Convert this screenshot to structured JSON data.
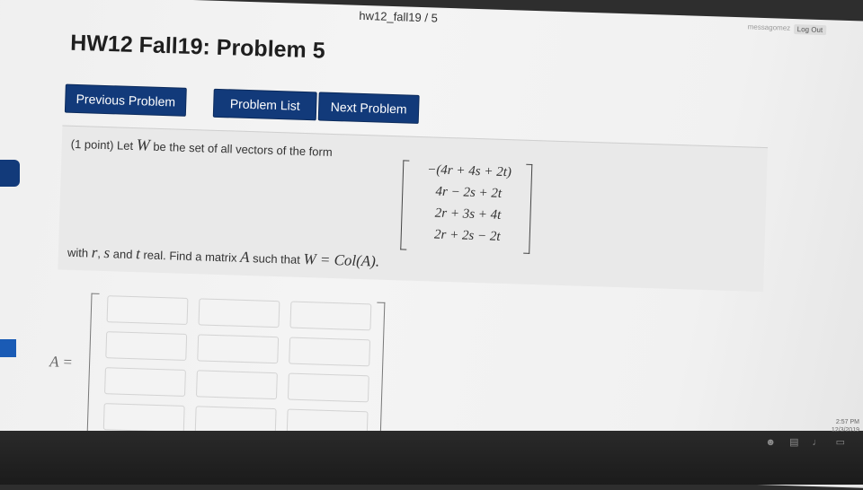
{
  "header": {
    "breadcrumb": "hw12_fall19 / 5",
    "username": "messagomez",
    "logout_label": "Log Out"
  },
  "page": {
    "title": "HW12 Fall19: Problem 5"
  },
  "nav": {
    "prev_label": "Previous Problem",
    "list_label": "Problem List",
    "next_label": "Next Problem"
  },
  "problem": {
    "points": "(1 point) Let",
    "var_W": "W",
    "intro_rest": "be the set of all vectors of the form",
    "vector_rows": [
      "−(4r + 4s + 2t)",
      "4r − 2s + 2t",
      "2r + 3s + 4t",
      "2r + 2s − 2t"
    ],
    "with_text": "with",
    "var_r": "r",
    "comma": ",",
    "var_s": "s",
    "and_text": "and",
    "var_t": "t",
    "find_text": "real. Find a matrix",
    "var_A": "A",
    "such_text": "such that",
    "equation": "W = Col(A)."
  },
  "answer": {
    "label": "A =",
    "rows": 4,
    "cols": 3
  },
  "taskbar": {
    "tray_icons": [
      "user-icon",
      "network-icon",
      "volume-icon",
      "battery-icon"
    ],
    "time": "2:57 PM",
    "date": "12/3/2019"
  }
}
